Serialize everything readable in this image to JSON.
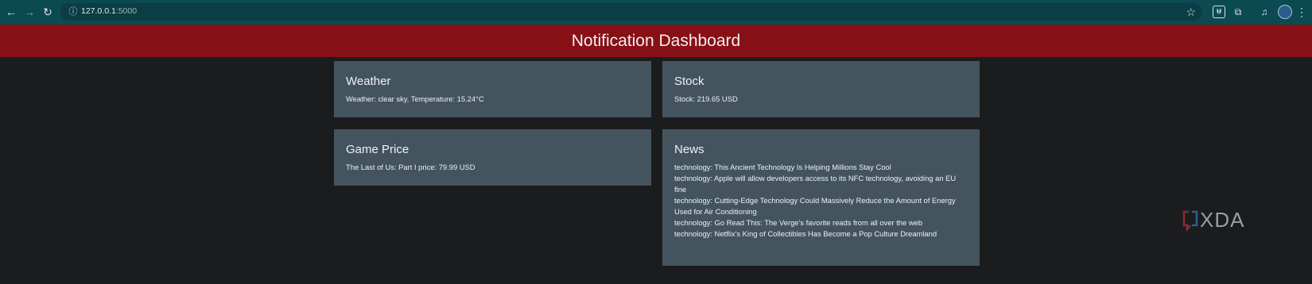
{
  "browser": {
    "url_host": "127.0.0.1",
    "url_port": ":5000"
  },
  "header": {
    "title": "Notification Dashboard",
    "bg_color": "#861015"
  },
  "cards": {
    "weather": {
      "title": "Weather",
      "text": "Weather: clear sky, Temperature: 15.24°C"
    },
    "stock": {
      "title": "Stock",
      "text": "Stock: 219.65 USD"
    },
    "game": {
      "title": "Game Price",
      "text": "The Last of Us: Part I price: 79.99 USD"
    },
    "news": {
      "title": "News",
      "items": [
        "technology: This Ancient Technology Is Helping Millions Stay Cool",
        "technology: Apple will allow developers access to its NFC technology, avoiding an EU fine",
        "technology: Cutting-Edge Technology Could Massively Reduce the Amount of Energy Used for Air Conditioning",
        "technology: Go Read This: The Verge's favorite reads from all over the web",
        "technology: Netflix's King of Collectibles Has Become a Pop Culture Dreamland"
      ]
    }
  },
  "watermark": {
    "text": "XDA"
  },
  "colors": {
    "page_bg": "#1b1c1e",
    "card_bg": "#44545f",
    "browser_bg": "#0c4a52"
  }
}
